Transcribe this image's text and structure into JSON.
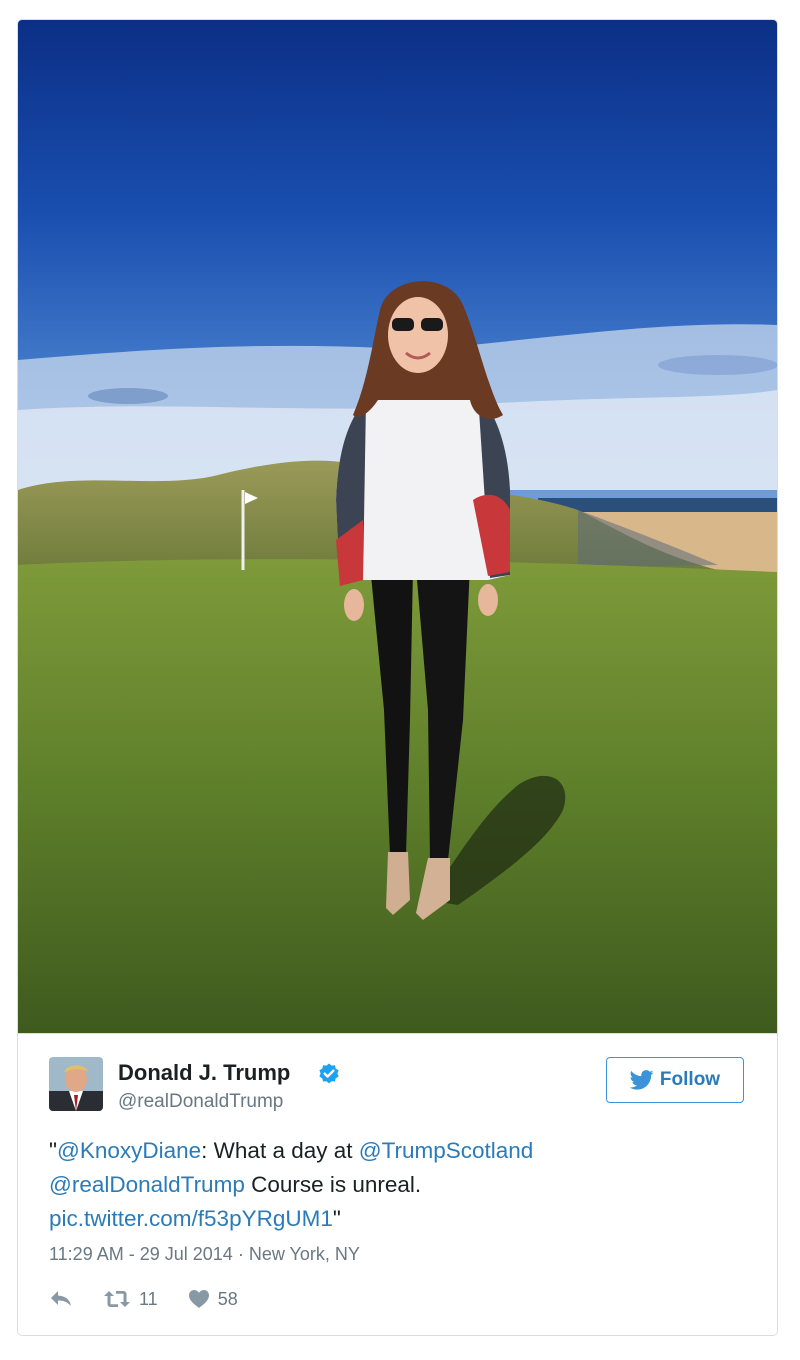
{
  "tweet": {
    "author_name": "Donald J. Trump",
    "author_handle": "@realDonaldTrump",
    "follow_label": "Follow",
    "text": {
      "q1": "\"",
      "mention1": "@KnoxyDiane",
      "t1": ": What a day at ",
      "mention2": "@TrumpScotland",
      "mention3": "@realDonaldTrump",
      "t2": " Course is unreal.",
      "link": "pic.twitter.com/f53pYRgUM1",
      "q2": "\""
    },
    "timestamp": "11:29 AM - 29 Jul 2014",
    "separator": "·",
    "location": "New York, NY",
    "retweets": "11",
    "likes": "58"
  },
  "colors": {
    "link": "#2b7bb9",
    "secondary_text": "#697882",
    "verified": "#1da1f2"
  },
  "icons": [
    "verified-badge-icon",
    "twitter-bird-icon",
    "reply-icon",
    "retweet-icon",
    "heart-icon"
  ]
}
